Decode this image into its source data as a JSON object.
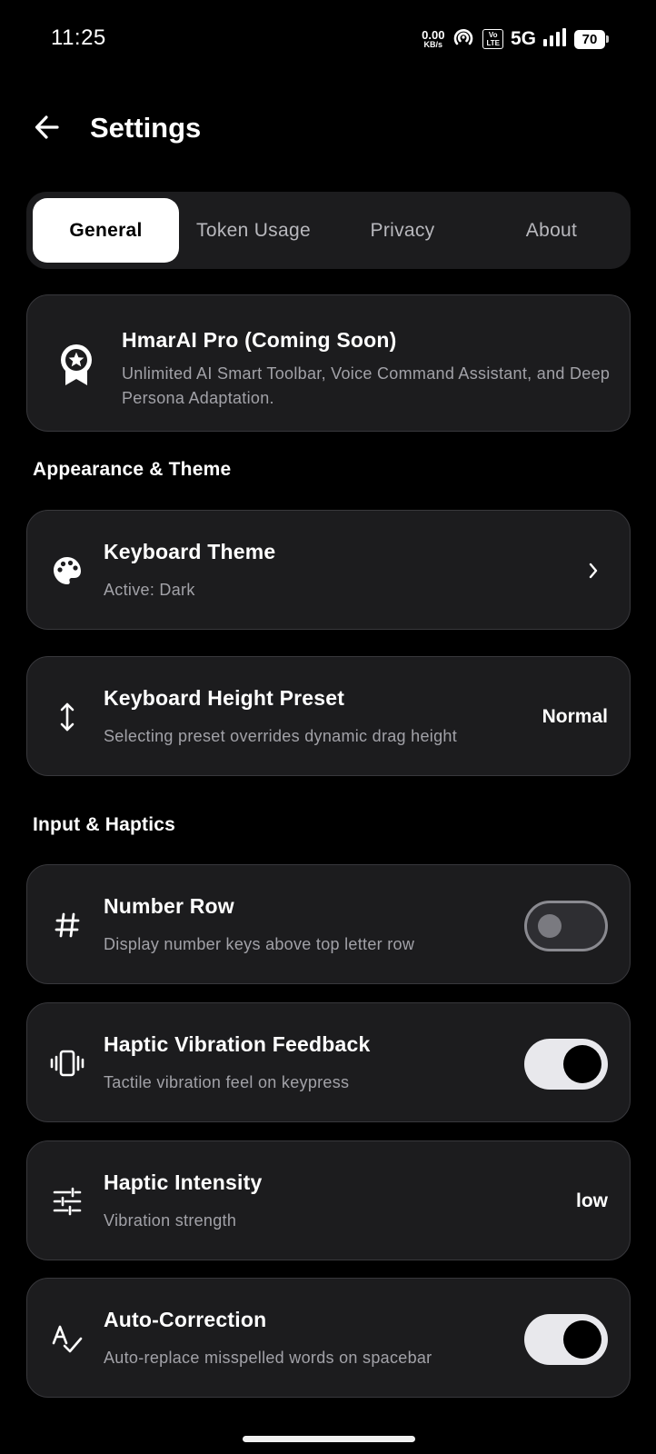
{
  "status_bar": {
    "time": "11:25",
    "net_speed_value": "0.00",
    "net_speed_unit": "KB/s",
    "volte_top": "Vo",
    "volte_bottom": "LTE",
    "network": "5G",
    "battery": "70"
  },
  "header": {
    "title": "Settings",
    "back_icon": "arrow-left-icon"
  },
  "tabs": [
    {
      "label": "General",
      "active": true
    },
    {
      "label": "Token Usage",
      "active": false
    },
    {
      "label": "Privacy",
      "active": false
    },
    {
      "label": "About",
      "active": false
    }
  ],
  "pro_card": {
    "icon": "award-ribbon-icon",
    "title": "HmarAI Pro (Coming Soon)",
    "description": "Unlimited AI Smart Toolbar, Voice Command Assistant, and Deep Persona Adaptation."
  },
  "sections": {
    "appearance": {
      "heading": "Appearance & Theme",
      "items": [
        {
          "icon": "palette-icon",
          "title": "Keyboard Theme",
          "subtitle": "Active: Dark",
          "control": "chevron"
        },
        {
          "icon": "vertical-arrows-icon",
          "title": "Keyboard Height Preset",
          "subtitle": "Selecting preset overrides dynamic drag height",
          "value": "Normal"
        }
      ]
    },
    "input": {
      "heading": "Input & Haptics",
      "items": [
        {
          "icon": "hash-icon",
          "title": "Number Row",
          "subtitle": "Display number keys above top letter row",
          "toggle": false
        },
        {
          "icon": "vibration-icon",
          "title": "Haptic Vibration Feedback",
          "subtitle": "Tactile vibration feel on keypress",
          "toggle": true
        },
        {
          "icon": "sliders-icon",
          "title": "Haptic Intensity",
          "subtitle": "Vibration strength",
          "value": "low"
        },
        {
          "icon": "spellcheck-icon",
          "title": "Auto-Correction",
          "subtitle": "Auto-replace misspelled words on spacebar",
          "toggle": true
        }
      ]
    }
  },
  "colors": {
    "background": "#000000",
    "card": "#1c1c1e",
    "card_border": "#38383c",
    "subtext": "#a2a2a8",
    "active_tab": "#ffffff"
  }
}
